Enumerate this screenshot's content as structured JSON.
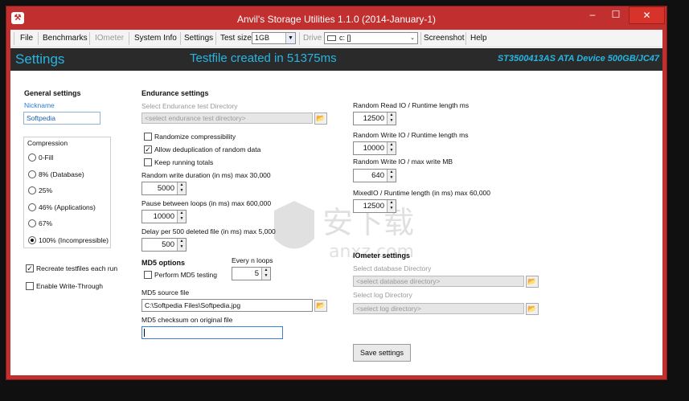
{
  "window": {
    "title": "Anvil's Storage Utilities 1.1.0 (2014-January-1)"
  },
  "menu": {
    "file": "File",
    "benchmarks": "Benchmarks",
    "iometer": "IOmeter",
    "system_info": "System Info",
    "settings": "Settings",
    "test_size_label": "Test size",
    "test_size_value": "1GB",
    "drive_label": "Drive",
    "drive_value": "c: []",
    "screenshot": "Screenshot",
    "help": "Help"
  },
  "header": {
    "title": "Settings",
    "status": "Testfile created in 51375ms",
    "device": "ST3500413AS ATA Device 500GB/JC47"
  },
  "general": {
    "heading": "General settings",
    "nickname_label": "Nickname",
    "nickname_value": "Softpedia",
    "compression_label": "Compression",
    "options": [
      {
        "label": "0-Fill",
        "selected": false
      },
      {
        "label": "8% (Database)",
        "selected": false
      },
      {
        "label": "25%",
        "selected": false
      },
      {
        "label": "46% (Applications)",
        "selected": false
      },
      {
        "label": "67%",
        "selected": false
      },
      {
        "label": "100% (Incompressible)",
        "selected": true
      }
    ],
    "recreate_label": "Recreate testfiles each run",
    "recreate_checked": true,
    "writethrough_label": "Enable Write-Through",
    "writethrough_checked": false
  },
  "endurance": {
    "heading": "Endurance settings",
    "dir_label": "Select Endurance test Directory",
    "dir_placeholder": "<select endurance test directory>",
    "randomize_label": "Randomize compressibility",
    "randomize_checked": false,
    "dedup_label": "Allow deduplication of random data",
    "dedup_checked": true,
    "keep_totals_label": "Keep running totals",
    "keep_totals_checked": false,
    "rw_duration_label": "Random write duration (in ms) max 30,000",
    "rw_duration_value": "5000",
    "pause_label": "Pause between loops (in ms) max 600,000",
    "pause_value": "10000",
    "delay_label": "Delay per 500 deleted file (in ms) max 5,000",
    "delay_value": "500"
  },
  "md5": {
    "heading": "MD5 options",
    "every_label": "Every n loops",
    "perform_label": "Perform MD5 testing",
    "perform_checked": false,
    "every_value": "5",
    "source_label": "MD5 source file",
    "source_value": "C:\\Softpedia Files\\Softpedia.jpg",
    "checksum_label": "MD5 checksum on original file",
    "checksum_value": ""
  },
  "runtime": {
    "rr_label": "Random Read IO / Runtime length ms",
    "rr_value": "12500",
    "rw_label": "Random Write IO / Runtime length ms",
    "rw_value": "10000",
    "rwmb_label": "Random Write IO / max write MB",
    "rwmb_value": "640",
    "mixed_label": "MixedIO / Runtime length (in ms) max 60,000",
    "mixed_value": "12500"
  },
  "iometer": {
    "heading": "IOmeter settings",
    "db_label": "Select database Directory",
    "db_placeholder": "<select database directory>",
    "log_label": "Select log Directory",
    "log_placeholder": "<select log directory>"
  },
  "save_button": "Save settings",
  "watermark": {
    "text": "安下载",
    "sub": "anxz.com"
  }
}
